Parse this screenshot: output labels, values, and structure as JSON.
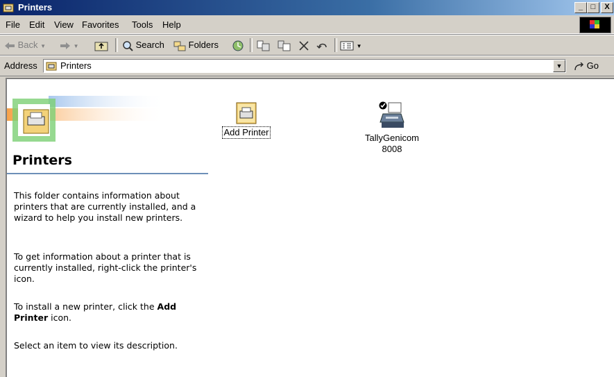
{
  "window": {
    "title": "Printers",
    "buttons": {
      "minimize": "_",
      "maximize": "□",
      "close": "X"
    }
  },
  "menubar": {
    "file": "File",
    "edit": "Edit",
    "view": "View",
    "favorites": "Favorites",
    "tools": "Tools",
    "help": "Help"
  },
  "toolbar": {
    "back": "Back",
    "search": "Search",
    "folders": "Folders"
  },
  "address": {
    "label": "Address",
    "value": "Printers",
    "go": "Go"
  },
  "left_panel": {
    "title": "Printers",
    "p1": "This folder contains information about printers that are currently installed, and a wizard to help you install new printers.",
    "p2": "To get information about a printer that is currently installed, right-click the printer's icon.",
    "p3_pre": "To install a new printer, click the ",
    "p3_bold": "Add Printer",
    "p3_post": " icon.",
    "p4": "Select an item to view its description."
  },
  "items": [
    {
      "label": "Add Printer"
    },
    {
      "label_line1": "TallyGenicom",
      "label_line2": "8008"
    }
  ],
  "colors": {
    "titlebar_start": "#0a246a",
    "titlebar_end": "#a6caf0",
    "rule": "#6d8fb8"
  }
}
